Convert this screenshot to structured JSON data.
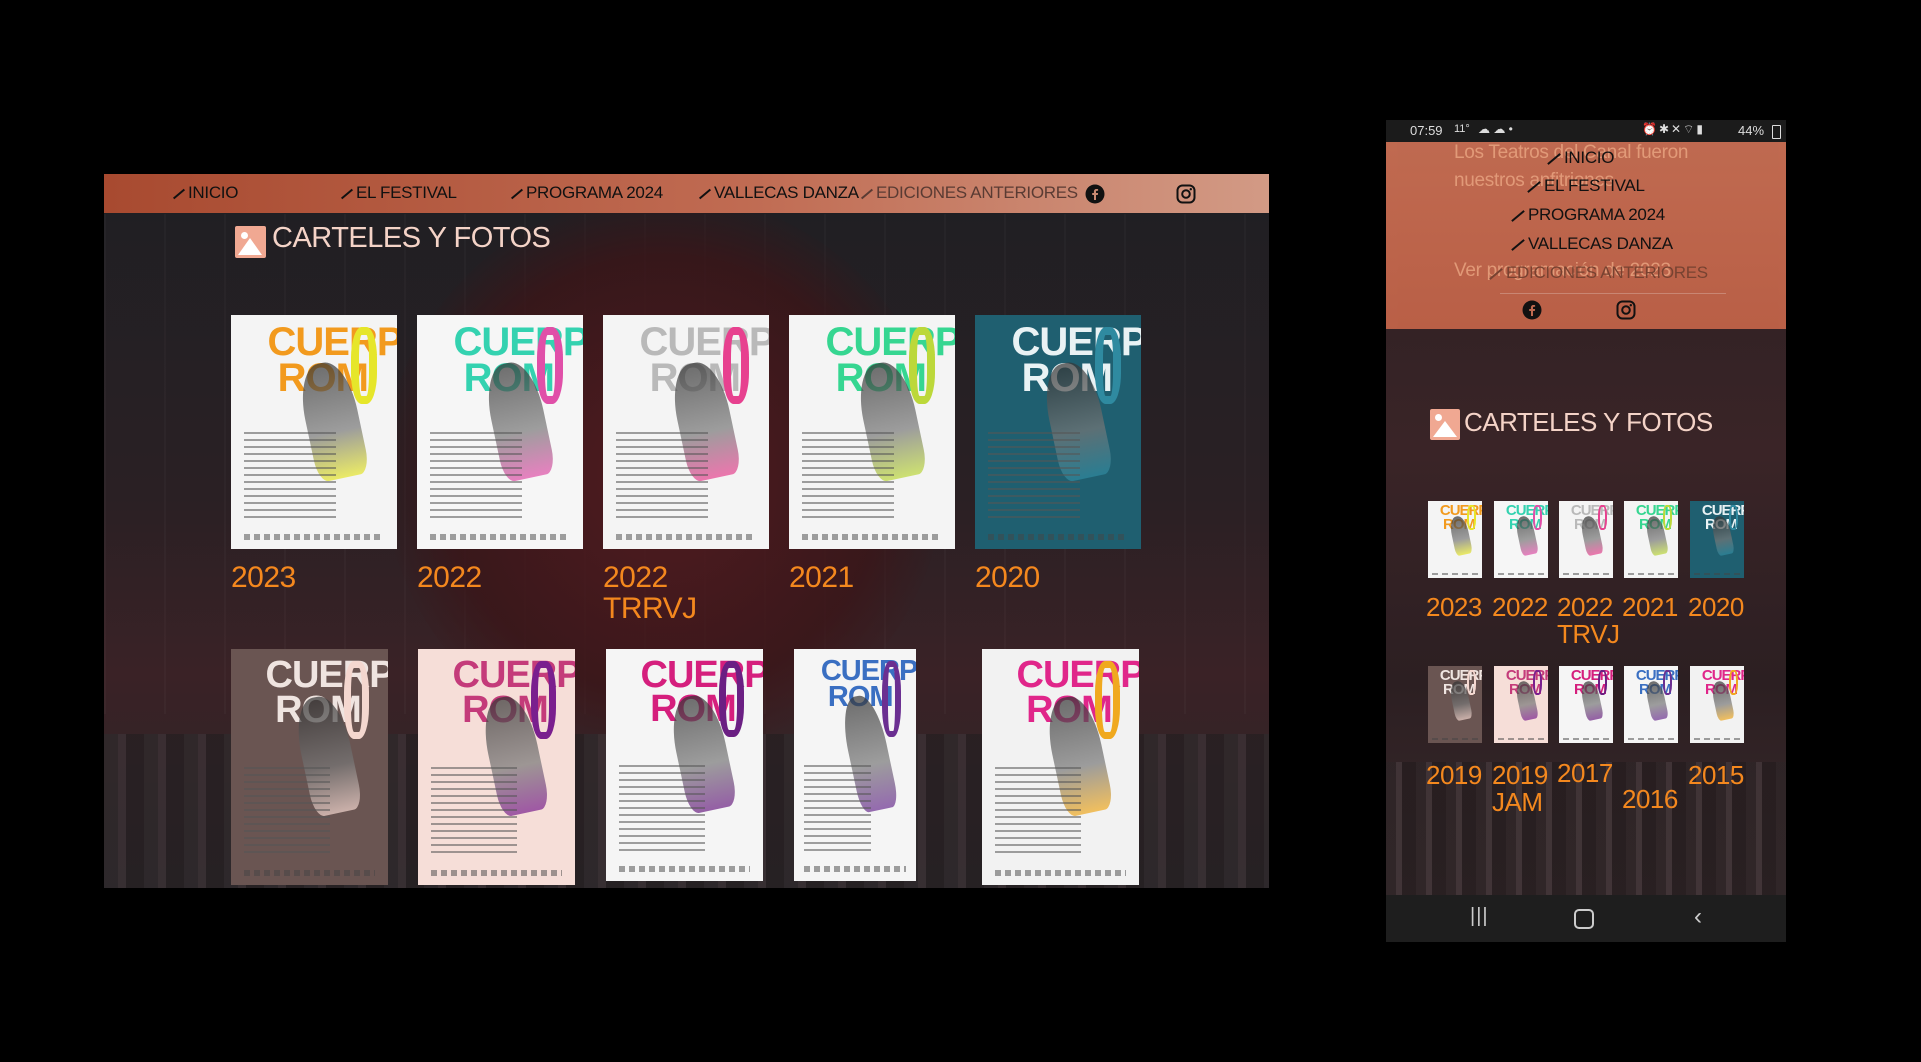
{
  "desktop": {
    "nav": {
      "items": [
        "INICIO",
        "EL FESTIVAL",
        "PROGRAMA 2024",
        "VALLECAS DANZA",
        "EDICIONES ANTERIORES"
      ],
      "social": [
        "facebook-icon",
        "instagram-icon"
      ]
    },
    "section_title": "CARTELES Y FOTOS",
    "posters": [
      {
        "year": "2023",
        "title": "CUERPO RO MO",
        "colors": {
          "bg": "#f4f4f4",
          "title": "#f29a1e",
          "accent": "#e6e62a"
        }
      },
      {
        "year": "2022",
        "title": "CUERPO RO MO",
        "colors": {
          "bg": "#f6f6f6",
          "title": "#34d2b0",
          "accent": "#e04fa8"
        }
      },
      {
        "year": "2022\nTRRVJ",
        "title": "CUERPO RO MO",
        "colors": {
          "bg": "#f4f4f4",
          "title": "#b9b9b9",
          "accent": "#e7418f"
        }
      },
      {
        "year": "2021",
        "title": "CUERPO RO MO",
        "colors": {
          "bg": "#f4f4f4",
          "title": "#36d691",
          "accent": "#bcd83a"
        }
      },
      {
        "year": "2020",
        "title": "CUERPO RO MO",
        "colors": {
          "bg": "#1f5f70",
          "title": "#e9f2f4",
          "accent": "#2f8aa0"
        }
      },
      {
        "year": "",
        "title": "CUERPO RO MO",
        "colors": {
          "bg": "#6a5552",
          "title": "#efe4e0",
          "accent": "#f4d7cf"
        }
      },
      {
        "year": "",
        "title": "CUERPO RO MO",
        "colors": {
          "bg": "#f6ded8",
          "title": "#c43b7a",
          "accent": "#7a1f8e"
        }
      },
      {
        "year": "",
        "title": "CUERPO RO MO",
        "colors": {
          "bg": "#f5f5f5",
          "title": "#d51f7d",
          "accent": "#6b1f83"
        }
      },
      {
        "year": "",
        "title": "CUERPO RO MO",
        "colors": {
          "bg": "#f5f5f5",
          "title": "#3a6fc2",
          "accent": "#6b2f91"
        }
      },
      {
        "year": "",
        "title": "CUERPO RO MO",
        "colors": {
          "bg": "#f2f2f2",
          "title": "#e0268a",
          "accent": "#f0a91f"
        }
      }
    ]
  },
  "phone": {
    "status": {
      "time": "07:59",
      "temp": "11°",
      "battery": "44%"
    },
    "behind_text": [
      "Los Teatros del Canal fueron",
      "nuestros anfitriones",
      "Ver programación de 2023"
    ],
    "nav_items": [
      "INICIO",
      "EL FESTIVAL",
      "PROGRAMA 2024",
      "VALLECAS DANZA",
      "EDICIONES ANTERIORES"
    ],
    "section_title": "CARTELES Y FOTOS",
    "years_row1": [
      "2023",
      "2022",
      "2022\nTRVJ",
      "2021",
      "2020"
    ],
    "years_row2": [
      "2019",
      "2019\nJAM",
      "2017",
      "2016",
      "2015"
    ]
  }
}
